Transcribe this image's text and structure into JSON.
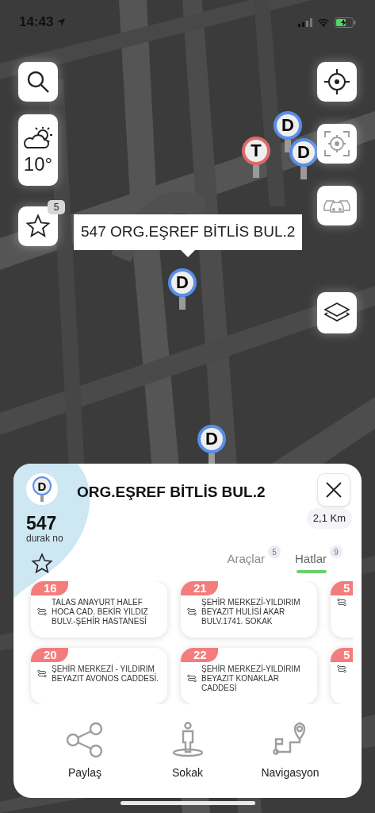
{
  "status_bar": {
    "time": "14:43"
  },
  "markers": [
    {
      "label": "T",
      "color": "#e06a6a"
    },
    {
      "label": "D",
      "color": "#5a8ee8"
    },
    {
      "label": "D",
      "color": "#5a8ee8"
    },
    {
      "label": "D",
      "color": "#5a8ee8"
    },
    {
      "label": "D",
      "color": "#5a8ee8"
    }
  ],
  "weather": {
    "temperature": "10°"
  },
  "favorites": {
    "count": "5"
  },
  "tooltip": "547 ORG.EŞREF BİTLİS BUL.2",
  "stop": {
    "badge": "D",
    "name": "ORG.EŞREF BİTLİS BUL.2",
    "number": "547",
    "number_label": "durak no",
    "favorite": false,
    "distance": "2,1 Km"
  },
  "tabs": [
    {
      "label": "Araçlar",
      "count": "5",
      "selected": false
    },
    {
      "label": "Hatlar",
      "count": "9",
      "selected": true
    }
  ],
  "routes": [
    [
      {
        "number": "16",
        "name": "TALAS ANAYURT HALEF HOCA CAD. BEKİR YILDIZ BULV.-ŞEHİR HASTANESİ"
      },
      {
        "number": "21",
        "name": "ŞEHİR MERKEZİ-YILDIRIM BEYAZIT HULİSİ AKAR BULV.1741. SOKAK"
      },
      {
        "number": "5"
      }
    ],
    [
      {
        "number": "20",
        "name": "ŞEHİR MERKEZİ - YILDIRIM BEYAZIT AVONOS CADDESİ."
      },
      {
        "number": "22",
        "name": "ŞEHİR MERKEZİ-YILDIRIM BEYAZIT KONAKLAR CADDESİ"
      },
      {
        "number": "5"
      }
    ]
  ],
  "actions": [
    {
      "kind": "share",
      "label": "Paylaş"
    },
    {
      "kind": "street",
      "label": "Sokak"
    },
    {
      "kind": "navigation",
      "label": "Navigasyon"
    }
  ]
}
